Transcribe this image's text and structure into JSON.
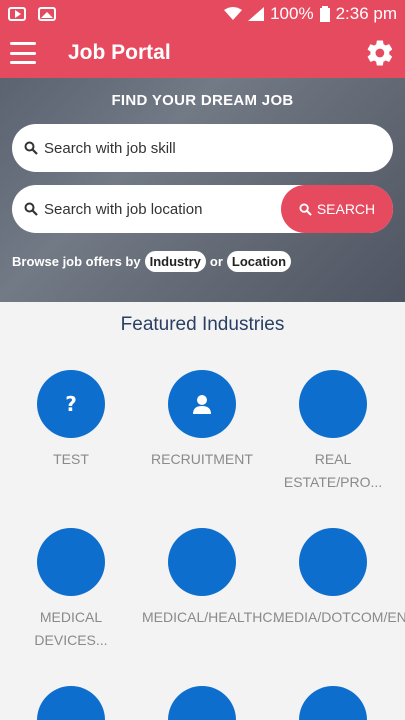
{
  "status_bar": {
    "battery": "100%",
    "time": "2:36 pm"
  },
  "app_bar": {
    "title": "Job Portal"
  },
  "hero": {
    "heading": "FIND YOUR DREAM JOB",
    "skill_placeholder": "Search with job skill",
    "location_placeholder": "Search with job location",
    "search_button": "SEARCH",
    "browse_prefix": "Browse job offers by",
    "browse_industry": "Industry",
    "browse_or": "or",
    "browse_location": "Location"
  },
  "featured": {
    "title": "Featured Industries",
    "items": [
      {
        "label": "TEST",
        "icon": "question-icon"
      },
      {
        "label": "RECRUITMENT",
        "icon": "person-icon"
      },
      {
        "label": "REAL ESTATE/PRO...",
        "icon": ""
      },
      {
        "label": "MEDICAL DEVICES...",
        "icon": ""
      },
      {
        "label": "MEDICAL/HEALTHC...",
        "icon": ""
      },
      {
        "label": "MEDIA/DOTCOM/EN...",
        "icon": ""
      },
      {
        "label": "",
        "icon": ""
      },
      {
        "label": "",
        "icon": ""
      },
      {
        "label": "",
        "icon": ""
      }
    ]
  },
  "colors": {
    "accent": "#e64a5f",
    "industry_circle": "#0e6ece",
    "title": "#2a3f62"
  }
}
